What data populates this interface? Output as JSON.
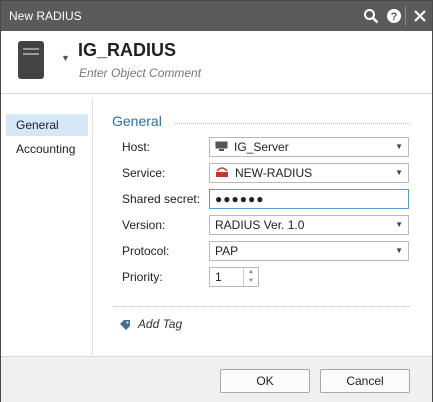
{
  "window": {
    "title": "New RADIUS"
  },
  "titlebar_icons": [
    "search-icon",
    "help-icon",
    "close-icon"
  ],
  "object": {
    "name": "IG_RADIUS",
    "comment_placeholder": "Enter Object Comment",
    "icon": "server-icon"
  },
  "nav": {
    "items": [
      {
        "label": "General",
        "active": true
      },
      {
        "label": "Accounting",
        "active": false
      }
    ]
  },
  "section": {
    "title": "General"
  },
  "form": {
    "host": {
      "label": "Host:",
      "value": "IG_Server",
      "icon": "host-icon"
    },
    "service": {
      "label": "Service:",
      "value": "NEW-RADIUS",
      "icon": "service-icon"
    },
    "secret": {
      "label": "Shared secret:",
      "value": "●●●●●●"
    },
    "version": {
      "label": "Version:",
      "value": "RADIUS Ver. 1.0"
    },
    "protocol": {
      "label": "Protocol:",
      "value": "PAP"
    },
    "priority": {
      "label": "Priority:",
      "value": "1"
    }
  },
  "tags": {
    "add_label": "Add Tag",
    "icon": "tag-icon"
  },
  "buttons": {
    "ok": "OK",
    "cancel": "Cancel"
  },
  "colors": {
    "titlebar": "#5b5b5b",
    "accent": "#2e6ea6",
    "nav_active": "#d6e7f7",
    "focus_border": "#5a9bd5"
  }
}
